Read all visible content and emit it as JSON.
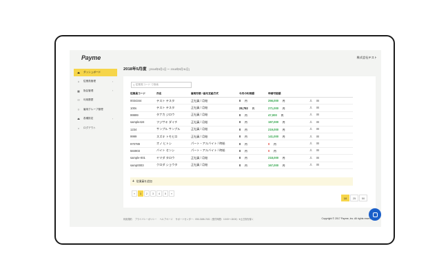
{
  "app": {
    "logo": "Payme",
    "company": "株式会社テスト"
  },
  "sidebar": {
    "items": [
      {
        "label": "ダッシュボード",
        "icon": "chart-icon",
        "glyph": "⏏",
        "active": true,
        "chev": ""
      },
      {
        "label": "従業員管理",
        "icon": "home-icon",
        "glyph": "⌂",
        "active": false,
        "chev": "›"
      },
      {
        "label": "勤怠管理",
        "icon": "grid-icon",
        "glyph": "▦",
        "active": false,
        "chev": "›"
      },
      {
        "label": "利用履歴",
        "icon": "history-icon",
        "glyph": "⚇",
        "active": false,
        "chev": ""
      },
      {
        "label": "雇用グループ管理",
        "icon": "flag-icon",
        "glyph": "⚐",
        "active": false,
        "chev": ""
      },
      {
        "label": "各種設定",
        "icon": "settings-icon",
        "glyph": "⏏",
        "active": false,
        "chev": "›"
      },
      {
        "label": "ログアウト",
        "icon": "logout-icon",
        "glyph": "○",
        "active": false,
        "chev": ""
      }
    ]
  },
  "page": {
    "title": "2018年5月度",
    "range": "[2018年5月1日 ～ 2018年5月31日]"
  },
  "search": {
    "placeholder": "従業員コード で検索"
  },
  "table": {
    "headers": [
      "従業員コード",
      "氏名",
      "雇用形態 / 給与支給方式",
      "今月の利用額",
      "申請可能額"
    ],
    "yen": "円",
    "rows": [
      {
        "code": "0034344",
        "name": "テスト テスタ",
        "type": "正社員 / 月給",
        "usage": "0",
        "avail": "256,000",
        "zero": false
      },
      {
        "code": "100s",
        "name": "テスト テスタ",
        "type": "正社員 / 月給",
        "usage": "28,782",
        "avail": "271,000",
        "zero": false
      },
      {
        "code": "99999",
        "name": "タナカ ジロウ",
        "type": "正社員 / 月給",
        "usage": "0",
        "avail": "47,000",
        "zero": false
      },
      {
        "code": "sample424",
        "name": "フジサキ ダイチ",
        "type": "正社員 / 月給",
        "usage": "0",
        "avail": "187,000",
        "zero": false
      },
      {
        "code": "1234",
        "name": "サンプル サンプル",
        "type": "正社員 / 月給",
        "usage": "0",
        "avail": "219,000",
        "zero": false
      },
      {
        "code": "9999",
        "name": "スズキ トモヒロ",
        "type": "正社員 / 月給",
        "usage": "0",
        "avail": "141,000",
        "zero": false
      },
      {
        "code": "970789",
        "name": "オノ ヒトシ",
        "type": "パート・アルバイト / 時給",
        "usage": "0",
        "avail": "0",
        "zero": true
      },
      {
        "code": "584903",
        "name": "バイト センシ",
        "type": "パート・アルバイト / 時給",
        "usage": "0",
        "avail": "0",
        "zero": true
      },
      {
        "code": "sample-001",
        "name": "ヤマダ タロウ",
        "type": "正社員 / 月給",
        "usage": "0",
        "avail": "218,000",
        "zero": false
      },
      {
        "code": "samp0003",
        "name": "クロダ ショウタ",
        "type": "正社員 / 月給",
        "usage": "0",
        "avail": "167,000",
        "zero": false
      }
    ],
    "actions": {
      "user_icon": "♙",
      "edit_icon": "⊟"
    }
  },
  "add_employee": {
    "plus": "+",
    "label": "従業員を追加"
  },
  "pagination": {
    "prev": "«",
    "pages": [
      "1",
      "2",
      "3",
      "4",
      "5"
    ],
    "next": "»",
    "active": "1"
  },
  "page_size": {
    "options": [
      "10",
      "25",
      "50"
    ],
    "active": "10"
  },
  "footer": {
    "links": [
      "利用規約",
      "プライバシーポリシー",
      "ヘルプページ",
      "サポートセンター：050-3186-7431（受付時間：10:00～18:00）※土日祝を除く"
    ],
    "copyright": "Copyright © 2017 Payme, Inc. All rights reserved."
  },
  "colors": {
    "accent": "#f6d54a",
    "positive": "#33a54c",
    "negative": "#e2453c",
    "chat": "#1a5fc9"
  }
}
